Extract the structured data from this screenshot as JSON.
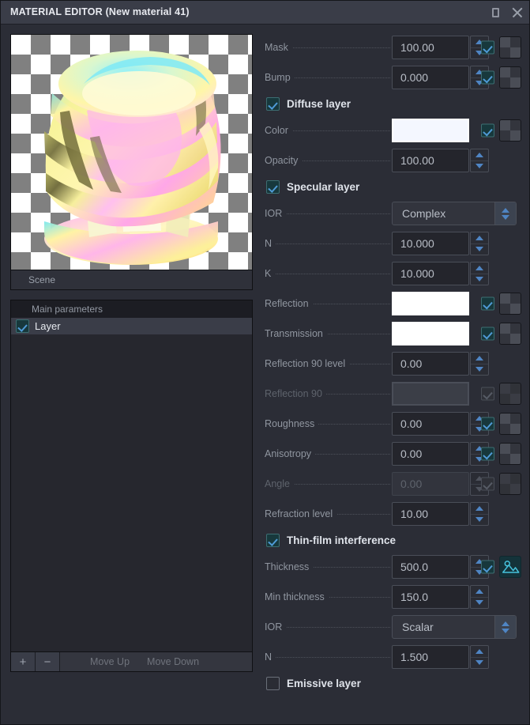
{
  "window": {
    "title": "MATERIAL EDITOR (New material 41)",
    "restore_icon": "restore-icon",
    "close_icon": "close-icon"
  },
  "preview": {
    "scene_label": "Scene",
    "background": "checkerboard"
  },
  "layers_panel": {
    "header": "Main parameters",
    "items": [
      {
        "label": "Layer",
        "checked": true
      }
    ],
    "toolbar": {
      "add_label": "+",
      "remove_label": "−",
      "move_up_label": "Move Up",
      "move_down_label": "Move Down"
    }
  },
  "properties": [
    {
      "kind": "spin",
      "label": "Mask",
      "value": "100.00",
      "checkbox": true,
      "texture": "checker",
      "enabled": true
    },
    {
      "kind": "spin",
      "label": "Bump",
      "value": "0.000",
      "checkbox": true,
      "texture": "checker",
      "enabled": true
    },
    {
      "kind": "header",
      "label": "Diffuse layer",
      "checked": true
    },
    {
      "kind": "color",
      "label": "Color",
      "value": "#f4f7ff",
      "checkbox": true,
      "texture": "checker",
      "enabled": true
    },
    {
      "kind": "spin",
      "label": "Opacity",
      "value": "100.00",
      "checkbox": false,
      "texture": "none",
      "enabled": true
    },
    {
      "kind": "header",
      "label": "Specular layer",
      "checked": true
    },
    {
      "kind": "combo",
      "label": "IOR",
      "value": "Complex",
      "enabled": true
    },
    {
      "kind": "spin",
      "label": "N",
      "value": "10.000",
      "checkbox": false,
      "texture": "none",
      "enabled": true
    },
    {
      "kind": "spin",
      "label": "K",
      "value": "10.000",
      "checkbox": false,
      "texture": "none",
      "enabled": true
    },
    {
      "kind": "color",
      "label": "Reflection",
      "value": "#ffffff",
      "checkbox": true,
      "texture": "checker",
      "enabled": true
    },
    {
      "kind": "color",
      "label": "Transmission",
      "value": "#ffffff",
      "checkbox": true,
      "texture": "checker",
      "enabled": true
    },
    {
      "kind": "spin",
      "label": "Reflection 90 level",
      "value": "0.00",
      "checkbox": false,
      "texture": "none",
      "enabled": true
    },
    {
      "kind": "color",
      "label": "Reflection 90",
      "value": "",
      "checkbox": true,
      "texture": "checker",
      "enabled": false
    },
    {
      "kind": "spin",
      "label": "Roughness",
      "value": "0.00",
      "checkbox": true,
      "texture": "checker",
      "enabled": true
    },
    {
      "kind": "spin",
      "label": "Anisotropy",
      "value": "0.00",
      "checkbox": true,
      "texture": "checker",
      "enabled": true
    },
    {
      "kind": "spin",
      "label": "Angle",
      "value": "0.00",
      "checkbox": true,
      "texture": "checker",
      "enabled": false
    },
    {
      "kind": "spin",
      "label": "Refraction level",
      "value": "10.00",
      "checkbox": false,
      "texture": "none",
      "enabled": true
    },
    {
      "kind": "header",
      "label": "Thin-film interference",
      "checked": true
    },
    {
      "kind": "spin",
      "label": "Thickness",
      "value": "500.0",
      "checkbox": true,
      "texture": "image",
      "enabled": true
    },
    {
      "kind": "spin",
      "label": "Min thickness",
      "value": "150.0",
      "checkbox": false,
      "texture": "none",
      "enabled": true
    },
    {
      "kind": "combo",
      "label": "IOR",
      "value": "Scalar",
      "enabled": true
    },
    {
      "kind": "spin",
      "label": "N",
      "value": "1.500",
      "checkbox": false,
      "texture": "none",
      "enabled": true
    },
    {
      "kind": "header",
      "label": "Emissive layer",
      "checked": false
    }
  ],
  "colors": {
    "accent": "#4f85c4",
    "checkbox_fill": "#17383c",
    "check_mark": "#4f9ad6",
    "panel_bg": "#2b2d36",
    "titlebar_bg": "#3a3d48"
  }
}
